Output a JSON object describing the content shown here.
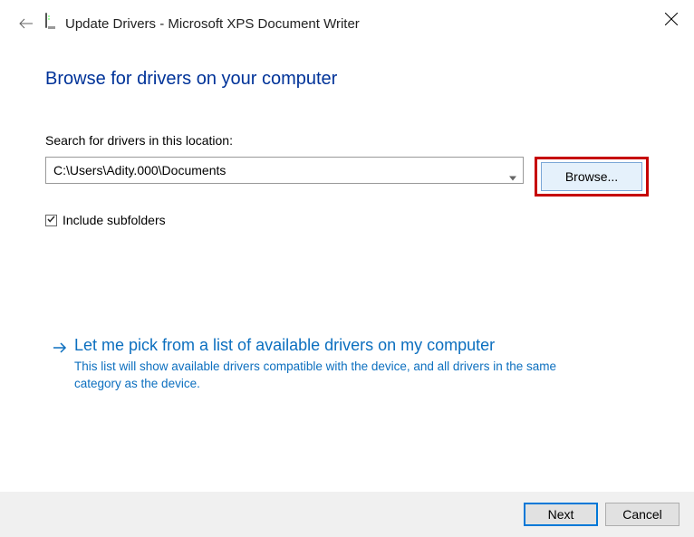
{
  "window": {
    "title": "Update Drivers - Microsoft XPS Document Writer"
  },
  "heading": "Browse for drivers on your computer",
  "search": {
    "label": "Search for drivers in this location:",
    "value": "C:\\Users\\Adity.000\\Documents",
    "browse_label": "Browse..."
  },
  "checkbox": {
    "label": "Include subfolders",
    "checked": true
  },
  "option": {
    "title": "Let me pick from a list of available drivers on my computer",
    "description": "This list will show available drivers compatible with the device, and all drivers in the same category as the device."
  },
  "footer": {
    "next_label": "Next",
    "cancel_label": "Cancel"
  }
}
